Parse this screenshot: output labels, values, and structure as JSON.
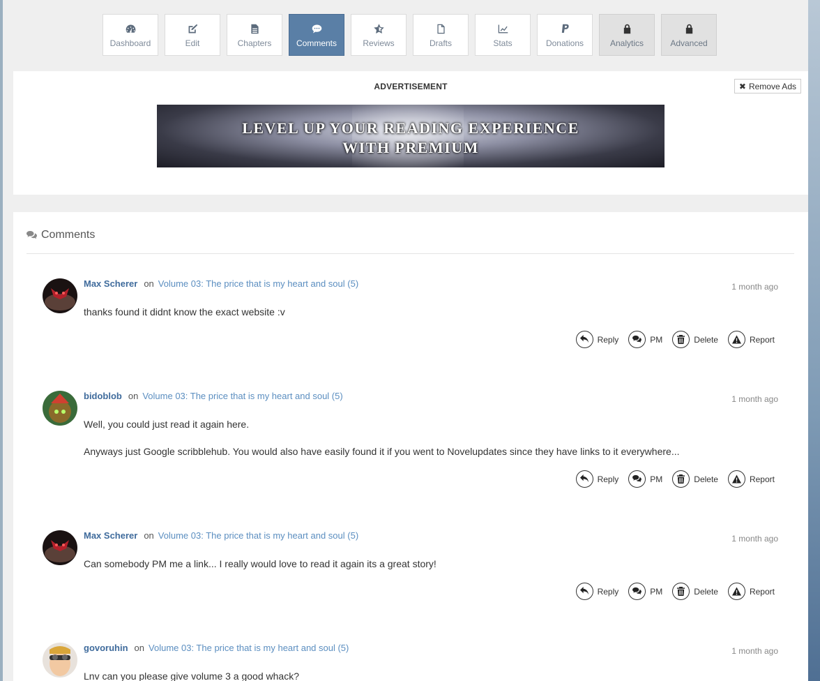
{
  "toolbar": {
    "items": [
      {
        "label": "Dashboard",
        "icon": "dashboard-icon",
        "state": "normal"
      },
      {
        "label": "Edit",
        "icon": "edit-icon",
        "state": "normal"
      },
      {
        "label": "Chapters",
        "icon": "document-icon",
        "state": "normal"
      },
      {
        "label": "Comments",
        "icon": "comments-icon",
        "state": "active"
      },
      {
        "label": "Reviews",
        "icon": "star-icon",
        "state": "normal"
      },
      {
        "label": "Drafts",
        "icon": "file-icon",
        "state": "normal"
      },
      {
        "label": "Stats",
        "icon": "line-chart-icon",
        "state": "normal"
      },
      {
        "label": "Donations",
        "icon": "paypal-icon",
        "state": "normal"
      },
      {
        "label": "Analytics",
        "icon": "lock-icon",
        "state": "locked"
      },
      {
        "label": "Advanced",
        "icon": "lock-icon",
        "state": "locked"
      }
    ],
    "active_color": "#5a7fa6"
  },
  "ad": {
    "label": "ADVERTISEMENT",
    "remove_label": "Remove Ads",
    "banner_line1": "LEVEL UP YOUR READING EXPERIENCE",
    "banner_line2": "WITH PREMIUM"
  },
  "comments": {
    "title": "Comments",
    "on_word": "on",
    "actions": {
      "reply": "Reply",
      "pm": "PM",
      "delete": "Delete",
      "report": "Report"
    },
    "items": [
      {
        "author": "Max Scherer",
        "chapter": "Volume 03: The price that is my heart and soul (5)",
        "time": "1 month ago",
        "lines": [
          "thanks found it didnt know the exact website :v"
        ]
      },
      {
        "author": "bidoblob",
        "chapter": "Volume 03: The price that is my heart and soul (5)",
        "time": "1 month ago",
        "lines": [
          "Well, you could just read it again here.",
          "Anyways just Google scribblehub. You would also have easily found it if you went to Novelupdates since they have links to it everywhere..."
        ]
      },
      {
        "author": "Max Scherer",
        "chapter": "Volume 03: The price that is my heart and soul (5)",
        "time": "1 month ago",
        "lines": [
          "Can somebody PM me a link... I really would love to read it again its a great story!"
        ]
      },
      {
        "author": "govoruhin",
        "chapter": "Volume 03: The price that is my heart and soul (5)",
        "time": "1 month ago",
        "lines": [
          "Lnv can you please give volume 3 a good whack?"
        ]
      }
    ]
  }
}
